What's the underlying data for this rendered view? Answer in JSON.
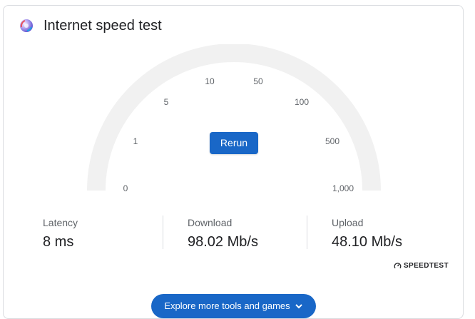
{
  "header": {
    "title": "Internet speed test",
    "logo_icon": "speedtest-logo-icon"
  },
  "gauge": {
    "ticks": [
      "0",
      "1",
      "5",
      "10",
      "50",
      "100",
      "500",
      "1,000"
    ],
    "track_color": "#f1f1f1"
  },
  "rerun_label": "Rerun",
  "stats": [
    {
      "label": "Latency",
      "value": "8 ms"
    },
    {
      "label": "Download",
      "value": "98.02 Mb/s"
    },
    {
      "label": "Upload",
      "value": "48.10 Mb/s"
    }
  ],
  "attribution": "SPEEDTEST",
  "explore_label": "Explore more tools and games",
  "colors": {
    "accent": "#1967c7",
    "text": "#202124",
    "muted": "#5f6368",
    "border": "#dadce0"
  }
}
